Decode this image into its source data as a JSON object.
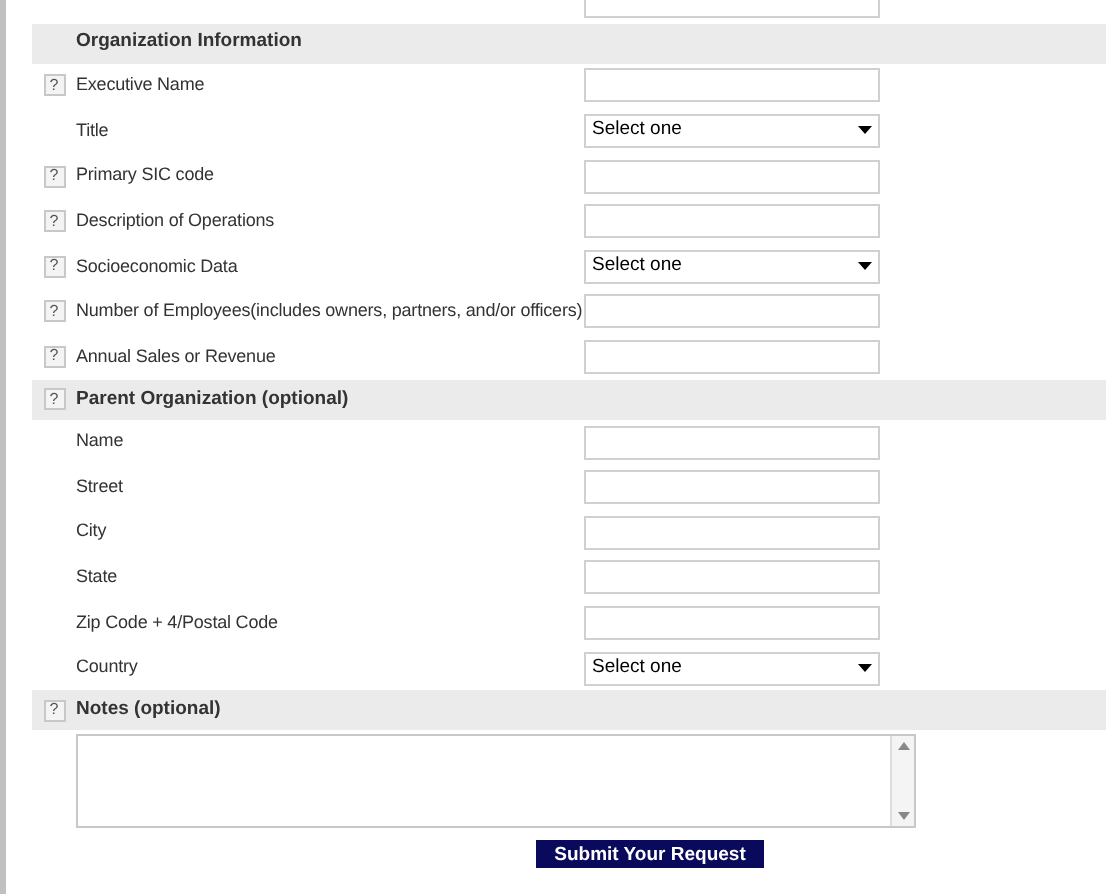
{
  "sections": [
    {
      "rows": [
        {
          "kind": "select-cut"
        }
      ]
    },
    {
      "title": "Organization Information",
      "rows": [
        {
          "label": "Executive Name",
          "help": "?",
          "kind": "input"
        },
        {
          "label": "Title",
          "kind": "select",
          "value": "Select one"
        },
        {
          "label": "Primary SIC code",
          "help": "?",
          "kind": "input"
        },
        {
          "label": "Description of Operations",
          "help": "?",
          "kind": "input"
        },
        {
          "label": "Socioeconomic Data",
          "help": "?",
          "kind": "select",
          "value": "Select one"
        },
        {
          "label": "Number of Employees(includes owners, partners, and/or officers)",
          "help": "?",
          "kind": "input"
        },
        {
          "label": "Annual Sales or Revenue",
          "help": "?",
          "kind": "input"
        }
      ]
    },
    {
      "title": "Parent Organization (optional)",
      "help": "?",
      "rows": [
        {
          "label": "Name",
          "kind": "input"
        },
        {
          "label": "Street",
          "kind": "input"
        },
        {
          "label": "City",
          "kind": "input"
        },
        {
          "label": "State",
          "kind": "input"
        },
        {
          "label": "Zip Code + 4/Postal Code",
          "kind": "input"
        },
        {
          "label": "Country",
          "kind": "select",
          "value": "Select one"
        }
      ]
    },
    {
      "title": "Notes (optional)",
      "help": "?",
      "rows": [
        {
          "kind": "textarea"
        }
      ]
    }
  ],
  "submit": "Submit Your Request"
}
